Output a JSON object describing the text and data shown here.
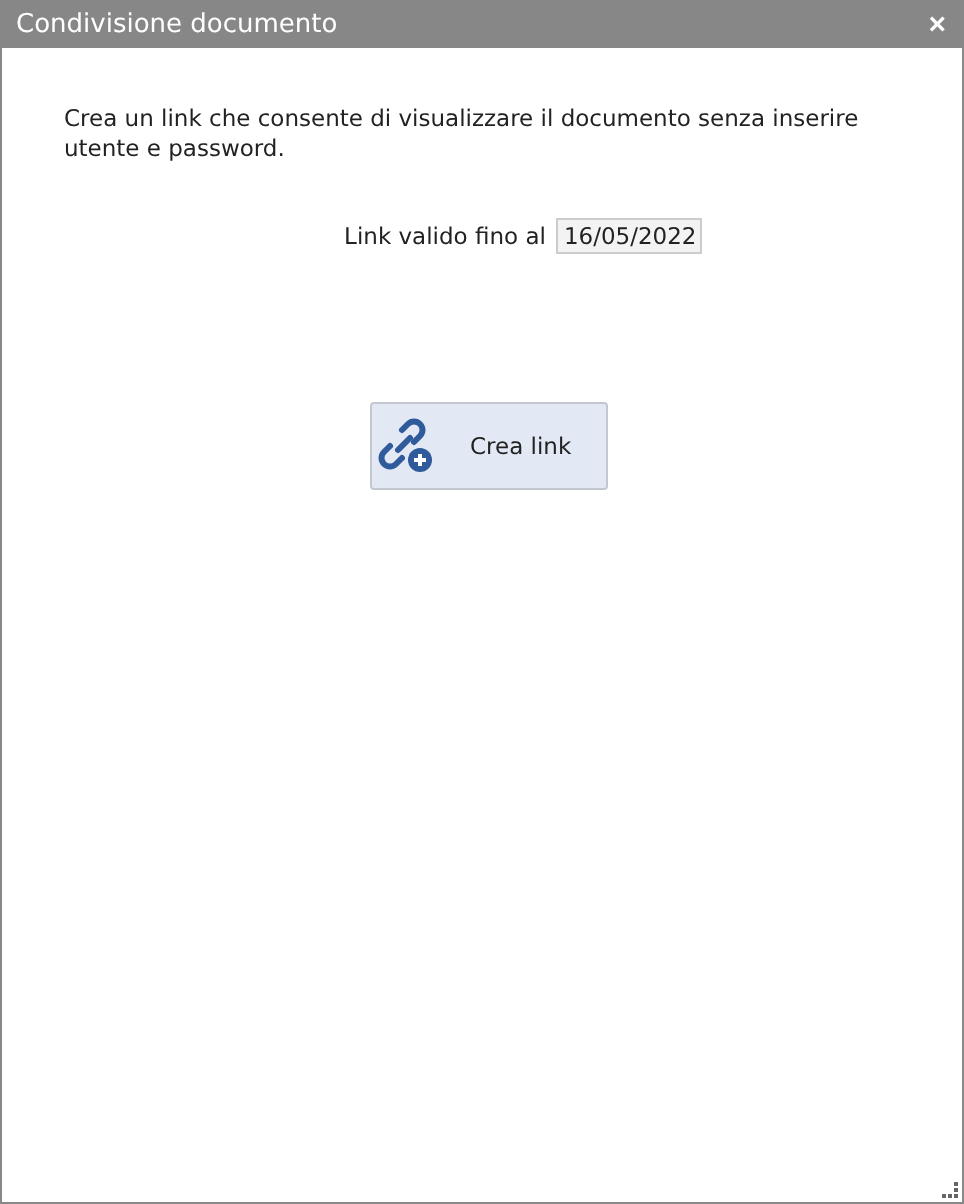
{
  "window": {
    "title": "Condivisione documento",
    "close": "×"
  },
  "description": "Crea un link che consente di visualizzare il documento senza inserire utente e password.",
  "expiry": {
    "label": "Link valido fino al",
    "value": "16/05/2022"
  },
  "button": {
    "label": "Crea link"
  }
}
